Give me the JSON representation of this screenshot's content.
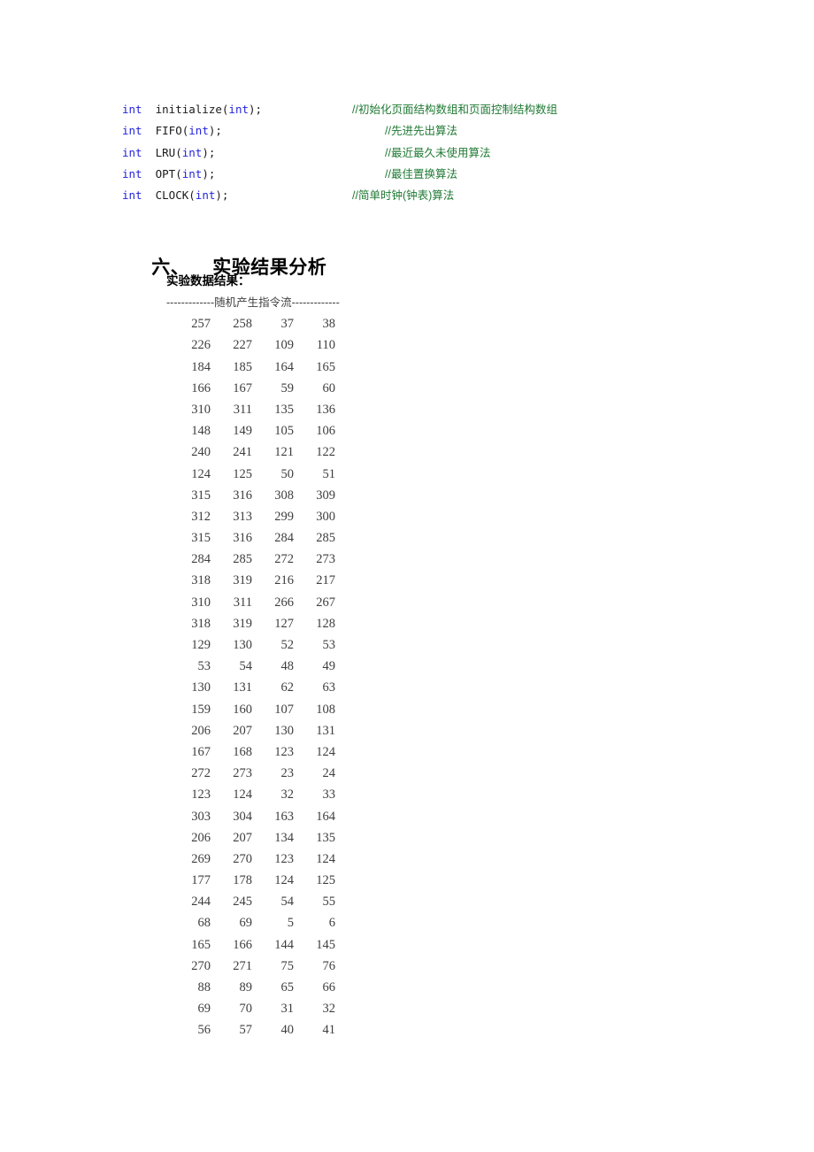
{
  "code_block": {
    "lines": [
      {
        "type_keyword": "int",
        "declaration": "initialize(",
        "param_keyword": "int",
        "declaration_end": ");",
        "comment": "//初始化页面结构数组和页面控制结构数组",
        "comment_indent": "a"
      },
      {
        "type_keyword": "int",
        "declaration": "FIFO(",
        "param_keyword": "int",
        "declaration_end": ");",
        "comment": "//先进先出算法",
        "comment_indent": "b"
      },
      {
        "type_keyword": "int",
        "declaration": "LRU(",
        "param_keyword": "int",
        "declaration_end": ");",
        "comment": "//最近最久未使用算法",
        "comment_indent": "b"
      },
      {
        "type_keyword": "int",
        "declaration": "OPT(",
        "param_keyword": "int",
        "declaration_end": ");",
        "comment": "//最佳置换算法",
        "comment_indent": "b"
      },
      {
        "type_keyword": "int",
        "declaration": "CLOCK(",
        "param_keyword": "int",
        "declaration_end": ");",
        "comment": "//简单时钟(钟表)算法",
        "comment_indent": "a"
      }
    ],
    "colors": {
      "keyword": "#2323dc",
      "identifier": "#1a1a1a",
      "comment": "#1f7a34"
    }
  },
  "section": {
    "number": "六、",
    "title": "实验结果分析"
  },
  "result": {
    "label": "实验数据结果：",
    "banner": "-------------随机产生指令流-------------"
  },
  "chart_data": {
    "type": "table",
    "title": "随机产生指令流",
    "columns": 4,
    "row_count": 33,
    "rows": [
      [
        257,
        258,
        37,
        38
      ],
      [
        226,
        227,
        109,
        110
      ],
      [
        184,
        185,
        164,
        165
      ],
      [
        166,
        167,
        59,
        60
      ],
      [
        310,
        311,
        135,
        136
      ],
      [
        148,
        149,
        105,
        106
      ],
      [
        240,
        241,
        121,
        122
      ],
      [
        124,
        125,
        50,
        51
      ],
      [
        315,
        316,
        308,
        309
      ],
      [
        312,
        313,
        299,
        300
      ],
      [
        315,
        316,
        284,
        285
      ],
      [
        284,
        285,
        272,
        273
      ],
      [
        318,
        319,
        216,
        217
      ],
      [
        310,
        311,
        266,
        267
      ],
      [
        318,
        319,
        127,
        128
      ],
      [
        129,
        130,
        52,
        53
      ],
      [
        53,
        54,
        48,
        49
      ],
      [
        130,
        131,
        62,
        63
      ],
      [
        159,
        160,
        107,
        108
      ],
      [
        206,
        207,
        130,
        131
      ],
      [
        167,
        168,
        123,
        124
      ],
      [
        272,
        273,
        23,
        24
      ],
      [
        123,
        124,
        32,
        33
      ],
      [
        303,
        304,
        163,
        164
      ],
      [
        206,
        207,
        134,
        135
      ],
      [
        269,
        270,
        123,
        124
      ],
      [
        177,
        178,
        124,
        125
      ],
      [
        244,
        245,
        54,
        55
      ],
      [
        68,
        69,
        5,
        6
      ],
      [
        165,
        166,
        144,
        145
      ],
      [
        270,
        271,
        75,
        76
      ],
      [
        88,
        89,
        65,
        66
      ],
      [
        69,
        70,
        31,
        32
      ],
      [
        56,
        57,
        40,
        41
      ]
    ]
  }
}
